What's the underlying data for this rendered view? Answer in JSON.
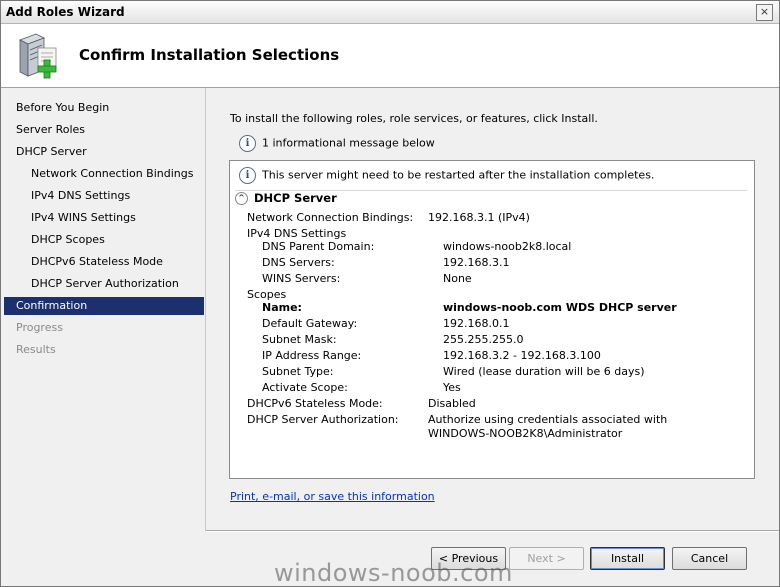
{
  "window": {
    "title": "Add Roles Wizard",
    "close_glyph": "×"
  },
  "header": {
    "title": "Confirm Installation Selections"
  },
  "sidebar": {
    "items": [
      {
        "label": "Before You Begin",
        "level": 1,
        "state": "normal"
      },
      {
        "label": "Server Roles",
        "level": 1,
        "state": "normal"
      },
      {
        "label": "DHCP Server",
        "level": 1,
        "state": "normal"
      },
      {
        "label": "Network Connection Bindings",
        "level": 2,
        "state": "normal"
      },
      {
        "label": "IPv4 DNS Settings",
        "level": 2,
        "state": "normal"
      },
      {
        "label": "IPv4 WINS Settings",
        "level": 2,
        "state": "normal"
      },
      {
        "label": "DHCP Scopes",
        "level": 2,
        "state": "normal"
      },
      {
        "label": "DHCPv6 Stateless Mode",
        "level": 2,
        "state": "normal"
      },
      {
        "label": "DHCP Server Authorization",
        "level": 2,
        "state": "normal"
      },
      {
        "label": "Confirmation",
        "level": 1,
        "state": "active"
      },
      {
        "label": "Progress",
        "level": 1,
        "state": "disabled"
      },
      {
        "label": "Results",
        "level": 1,
        "state": "disabled"
      }
    ]
  },
  "main": {
    "intro": "To install the following roles, role services, or features, click Install.",
    "info_message": "1 informational message below",
    "notice": "This server might need to be restarted after the installation completes.",
    "section_title": "DHCP Server",
    "details": {
      "bindings_label": "Network Connection Bindings:",
      "bindings_value": "192.168.3.1 (IPv4)",
      "ipv4_dns_label": "IPv4 DNS Settings",
      "dns_parent_label": "DNS Parent Domain:",
      "dns_parent_value": "windows-noob2k8.local",
      "dns_servers_label": "DNS Servers:",
      "dns_servers_value": "192.168.3.1",
      "wins_label": "WINS Servers:",
      "wins_value": "None",
      "scopes_label": "Scopes",
      "name_label": "Name:",
      "name_value": "windows-noob.com WDS DHCP server",
      "gateway_label": "Default Gateway:",
      "gateway_value": "192.168.0.1",
      "subnet_label": "Subnet Mask:",
      "subnet_value": "255.255.255.0",
      "range_label": "IP Address Range:",
      "range_value": "192.168.3.2 - 192.168.3.100",
      "subnet_type_label": "Subnet Type:",
      "subnet_type_value": "Wired (lease duration will be 6 days)",
      "activate_label": "Activate Scope:",
      "activate_value": "Yes",
      "dhcpv6_label": "DHCPv6 Stateless Mode:",
      "dhcpv6_value": "Disabled",
      "auth_label": "DHCP Server Authorization:",
      "auth_value_line1": "Authorize using credentials associated with",
      "auth_value_line2": "WINDOWS-NOOB2K8\\Administrator"
    },
    "link": "Print, e-mail, or save this information"
  },
  "buttons": {
    "previous": "< Previous",
    "next": "Next >",
    "install": "Install",
    "cancel": "Cancel"
  },
  "watermark": "windows-noob.com",
  "icons": {
    "info": "i",
    "collapse": "^"
  },
  "colors": {
    "active_nav": "#1c2f6e",
    "link": "#0033cc"
  }
}
